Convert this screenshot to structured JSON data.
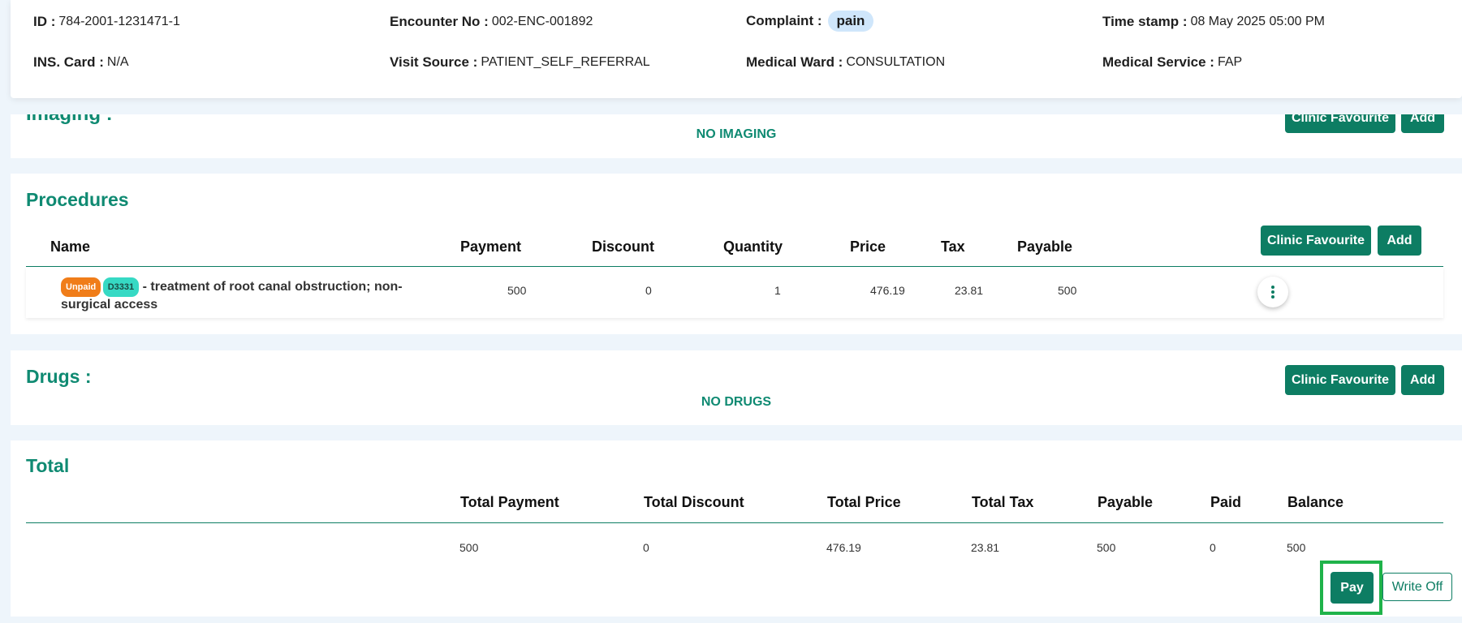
{
  "header": {
    "id": {
      "label": "ID :",
      "value": "784-2001-1231471-1"
    },
    "encounter": {
      "label": "Encounter No :",
      "value": "002-ENC-001892"
    },
    "complaint": {
      "label": "Complaint :",
      "value": "pain"
    },
    "timestamp": {
      "label": "Time stamp :",
      "value": "08 May 2025 05:00 PM"
    },
    "ins_card": {
      "label": "INS. Card :",
      "value": "N/A"
    },
    "visit_source": {
      "label": "Visit Source :",
      "value": "PATIENT_SELF_REFERRAL"
    },
    "medical_ward": {
      "label": "Medical Ward :",
      "value": "CONSULTATION"
    },
    "medical_service": {
      "label": "Medical Service :",
      "value": "FAP"
    }
  },
  "imaging": {
    "title": "Imaging :",
    "empty_text": "NO IMAGING",
    "clinic_favourite_label": "Clinic Favourite",
    "add_label": "Add"
  },
  "procedures": {
    "title": "Procedures",
    "clinic_favourite_label": "Clinic Favourite",
    "add_label": "Add",
    "columns": {
      "name": "Name",
      "payment": "Payment",
      "discount": "Discount",
      "quantity": "Quantity",
      "price": "Price",
      "tax": "Tax",
      "payable": "Payable"
    },
    "rows": [
      {
        "status": "Unpaid",
        "code": "D3331",
        "name": "- treatment of root canal obstruction; non-surgical access",
        "payment": "500",
        "discount": "0",
        "quantity": "1",
        "price": "476.19",
        "tax": "23.81",
        "payable": "500"
      }
    ]
  },
  "drugs": {
    "title": "Drugs :",
    "empty_text": "NO DRUGS",
    "clinic_favourite_label": "Clinic Favourite",
    "add_label": "Add"
  },
  "total": {
    "title": "Total",
    "columns": {
      "total_payment": "Total Payment",
      "total_discount": "Total Discount",
      "total_price": "Total Price",
      "total_tax": "Total Tax",
      "payable": "Payable",
      "paid": "Paid",
      "balance": "Balance"
    },
    "values": {
      "total_payment": "500",
      "total_discount": "0",
      "total_price": "476.19",
      "total_tax": "23.81",
      "payable": "500",
      "paid": "0",
      "balance": "500"
    },
    "pay_label": "Pay",
    "write_off_label": "Write Off"
  },
  "colors": {
    "accent": "#0d7d63",
    "title": "#0f8a72",
    "unpaid_badge": "#f07d19",
    "code_badge": "#36d9c4",
    "complaint_pill": "#cfe6fb",
    "highlight_frame": "#1fb34a"
  }
}
